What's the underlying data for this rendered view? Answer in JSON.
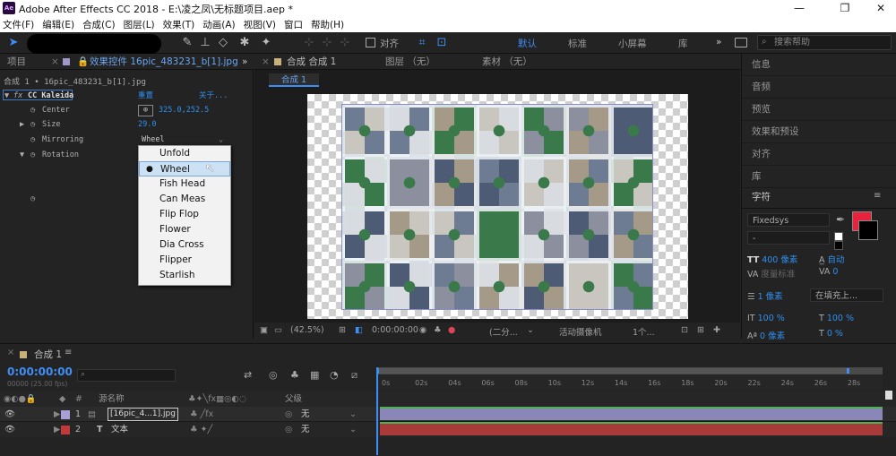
{
  "window": {
    "title": "Adobe After Effects CC 2018 - E:\\凌之凤\\无标题项目.aep *",
    "app_badge": "Ae",
    "min_glyph": "—",
    "max_glyph": "❐",
    "close_glyph": "✕"
  },
  "menu": [
    "文件(F)",
    "编辑(E)",
    "合成(C)",
    "图层(L)",
    "效果(T)",
    "动画(A)",
    "视图(V)",
    "窗口",
    "帮助(H)"
  ],
  "toolbar": {
    "snap_label": "对齐",
    "workspaces": [
      "默认",
      "标准",
      "小屏幕",
      "库"
    ],
    "active_workspace": "默认",
    "search_placeholder": "搜索帮助"
  },
  "left_panel": {
    "tabs": [
      "项目",
      "效果控件 16pic_483231_b[1].jpg"
    ],
    "layer_path": "合成 1 • 16pic_483231_b[1].jpg",
    "effect": {
      "name": "CC Kaleida",
      "reset": "重置",
      "about": "关于..."
    },
    "props": [
      {
        "label": "Center",
        "value": "325.0,252.5"
      },
      {
        "label": "Size",
        "value": "29.0"
      },
      {
        "label": "Mirroring",
        "value": "Wheel"
      },
      {
        "label": "Rotation",
        "value": ""
      }
    ]
  },
  "dropdown": {
    "options": [
      "Unfold",
      "Wheel",
      "Fish Head",
      "Can Meas",
      "Flip Flop",
      "Flower",
      "Dia Cross",
      "Flipper",
      "Starlish"
    ],
    "selected": "Wheel"
  },
  "viewer": {
    "tabs": [
      "合成 合成 1",
      "图层 （无）",
      "素材 （无）"
    ],
    "comp_tab": "合成 1",
    "zoom": "(42.5%)",
    "timecode": "0:00:00:00",
    "resolution": "(二分...",
    "camera": "活动摄像机",
    "views": "1个..."
  },
  "right_panel": {
    "items": [
      "信息",
      "音频",
      "预览",
      "效果和预设",
      "对齐",
      "库"
    ],
    "character": {
      "title": "字符",
      "font": "Fixedsys",
      "style": "-",
      "size": "400 像素",
      "leading": "自动",
      "kerning": "度量标准",
      "tracking": "0",
      "stroke": "1 像素",
      "stroke_mode": "在填充上...",
      "vscale": "100 %",
      "hscale": "100 %",
      "baseline": "0 像素",
      "tsume": "0 %",
      "fill_color": "#e8223c",
      "stroke_color": "#000000"
    }
  },
  "timeline": {
    "comp_tab": "合成 1",
    "timecode": "0:00:00:00",
    "fps": "00000 (25.00 fps)",
    "columns": {
      "source": "源名称",
      "parent": "父级"
    },
    "ticks": [
      "0s",
      "02s",
      "04s",
      "06s",
      "08s",
      "10s",
      "12s",
      "14s",
      "16s",
      "18s",
      "20s",
      "22s",
      "24s",
      "26s",
      "28s"
    ],
    "layers": [
      {
        "num": "1",
        "name": "[16pic_4...1].jpg",
        "parent": "无",
        "color": "#a9a0d6",
        "bar": "#8a87b8"
      },
      {
        "num": "2",
        "name": "文本",
        "parent": "无",
        "color": "#c03a3a",
        "bar": "#a83a3a"
      }
    ]
  }
}
